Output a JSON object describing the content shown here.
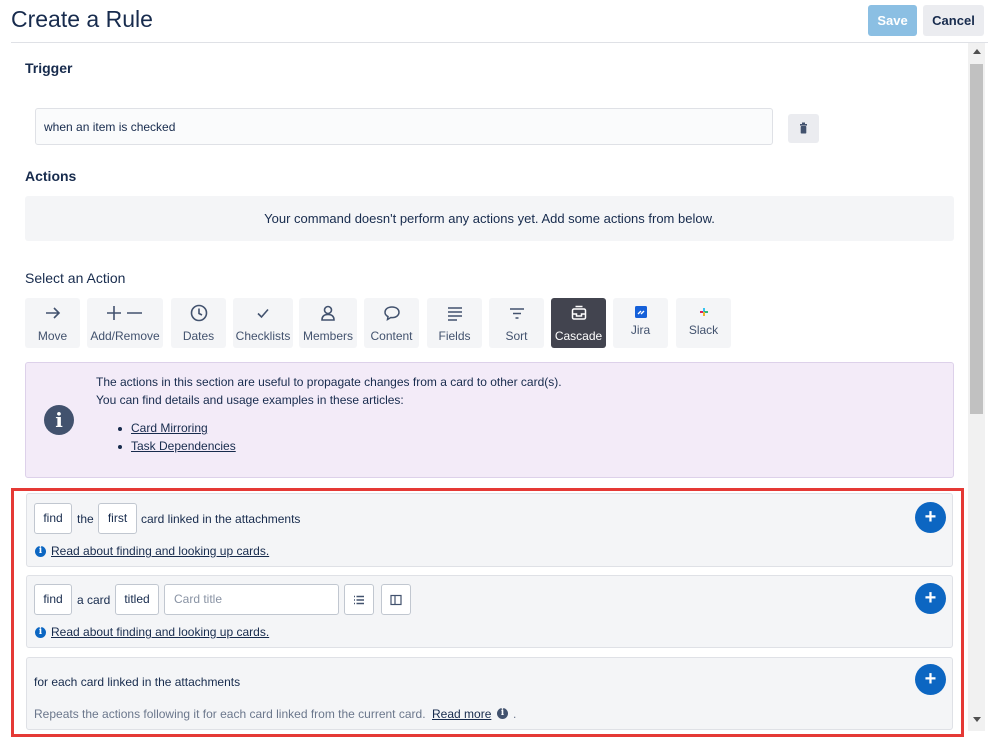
{
  "header": {
    "title": "Create a Rule",
    "save_label": "Save",
    "cancel_label": "Cancel"
  },
  "trigger": {
    "label": "Trigger",
    "text": "when an item is checked"
  },
  "actions": {
    "label": "Actions",
    "empty_message": "Your command doesn't perform any actions yet. Add some actions from below."
  },
  "select_action": {
    "label": "Select an Action",
    "tiles": [
      {
        "label": "Move",
        "icon": "arrow-right-icon"
      },
      {
        "label": "Add/Remove",
        "icon": "plus-minus-icon"
      },
      {
        "label": "Dates",
        "icon": "clock-icon"
      },
      {
        "label": "Checklists",
        "icon": "checkmark-icon"
      },
      {
        "label": "Members",
        "icon": "person-icon"
      },
      {
        "label": "Content",
        "icon": "speech-bubble-icon"
      },
      {
        "label": "Fields",
        "icon": "lines-icon"
      },
      {
        "label": "Sort",
        "icon": "sort-icon"
      },
      {
        "label": "Cascade",
        "icon": "inbox-icon",
        "active": true
      },
      {
        "label": "Jira",
        "icon": "jira-icon"
      },
      {
        "label": "Slack",
        "icon": "slack-icon"
      }
    ]
  },
  "info": {
    "line1": "The actions in this section are useful to propagate changes from a card to other card(s).",
    "line2": "You can find details and usage examples in these articles:",
    "links": [
      "Card Mirroring",
      "Task Dependencies"
    ]
  },
  "cards": {
    "find_linked": {
      "find": "find",
      "the": "the",
      "first": "first",
      "tail": "card linked in the attachments",
      "help": "Read about finding and looking up cards."
    },
    "find_titled": {
      "find": "find",
      "a_card": "a card",
      "titled": "titled",
      "placeholder": "Card title",
      "help": "Read about finding and looking up cards."
    },
    "for_each": {
      "text": "for each card linked in the attachments",
      "desc": "Repeats the actions following it for each card linked from the current card.",
      "read_more": "Read more",
      "period": "."
    }
  },
  "colors": {
    "accent": "#0c66c2",
    "save_disabled": "#8bbfe3",
    "cascade_active": "#42444f",
    "highlight_frame": "#e53935",
    "info_bg": "#f3ebf8"
  }
}
